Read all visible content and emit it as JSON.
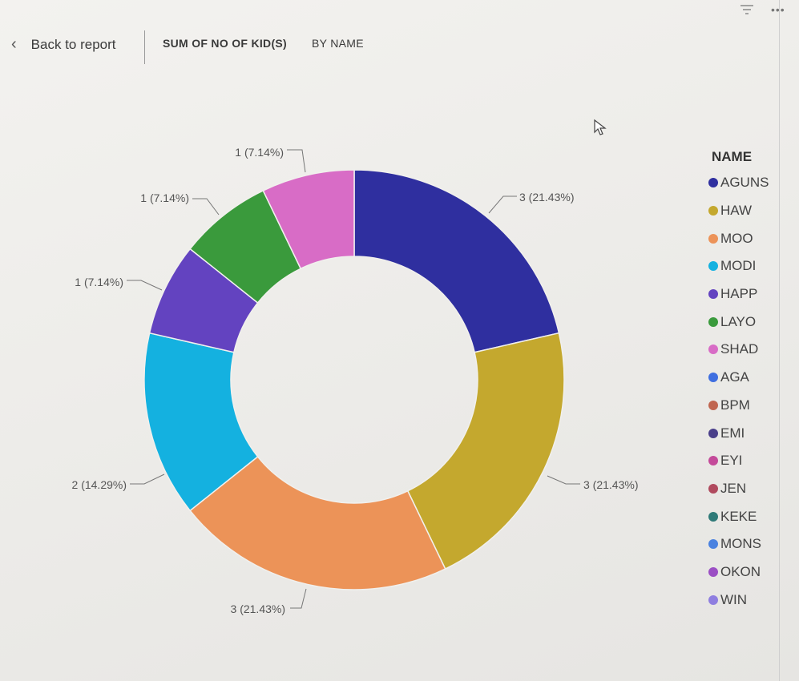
{
  "header": {
    "back_label": "Back to report",
    "title_measure": "SUM OF NO OF KID(S)",
    "title_group": "BY NAME"
  },
  "icons": {
    "back": "chevron-left-icon",
    "filter": "filter-icon",
    "more": "more-options-icon",
    "cursor": "mouse-pointer-icon"
  },
  "chart_data": {
    "type": "donut",
    "title": "SUM OF NO OF KID(S) BY NAME",
    "legend_title": "NAME",
    "legend_position": "right",
    "categories": [
      "AGUNS",
      "HAW",
      "MOO",
      "MODI",
      "HAPP",
      "LAYO",
      "SHAD",
      "AGA",
      "BPM",
      "EMI",
      "EYI",
      "JEN",
      "KEKE",
      "MONS",
      "OKON",
      "WIN"
    ],
    "colors": [
      "#2f2f9f",
      "#c4a82e",
      "#ec9358",
      "#14b1e0",
      "#6343c0",
      "#3a9a3c",
      "#d86cc6",
      "#3f6fe0",
      "#c0654f",
      "#4a3f8a",
      "#c44a9a",
      "#b04a5e",
      "#2f7a78",
      "#4a82e0",
      "#9b4fc4",
      "#8f7ee0"
    ],
    "values": [
      3,
      3,
      3,
      2,
      1,
      1,
      1
    ],
    "labels": [
      "3 (21.43%)",
      "3 (21.43%)",
      "3 (21.43%)",
      "2 (14.29%)",
      "1 (7.14%)",
      "1 (7.14%)",
      "1 (7.14%)"
    ]
  }
}
